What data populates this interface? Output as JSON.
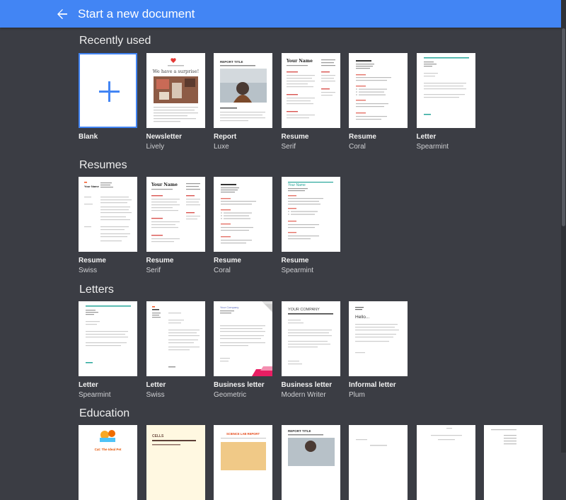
{
  "header": {
    "title": "Start a new document",
    "accent": "#4285f4"
  },
  "sections": {
    "recent": {
      "title": "Recently used",
      "items": [
        {
          "name": "Blank",
          "sub": ""
        },
        {
          "name": "Newsletter",
          "sub": "Lively",
          "preview_heading": "We have a surprise!"
        },
        {
          "name": "Report",
          "sub": "Luxe",
          "preview_heading": "REPORT TITLE"
        },
        {
          "name": "Resume",
          "sub": "Serif",
          "preview_heading": "Your Name"
        },
        {
          "name": "Resume",
          "sub": "Coral"
        },
        {
          "name": "Letter",
          "sub": "Spearmint"
        }
      ]
    },
    "resumes": {
      "title": "Resumes",
      "items": [
        {
          "name": "Resume",
          "sub": "Swiss",
          "preview_heading": "Your Name"
        },
        {
          "name": "Resume",
          "sub": "Serif",
          "preview_heading": "Your Name"
        },
        {
          "name": "Resume",
          "sub": "Coral"
        },
        {
          "name": "Resume",
          "sub": "Spearmint",
          "preview_heading": "Your Name"
        }
      ]
    },
    "letters": {
      "title": "Letters",
      "items": [
        {
          "name": "Letter",
          "sub": "Spearmint"
        },
        {
          "name": "Letter",
          "sub": "Swiss"
        },
        {
          "name": "Business letter",
          "sub": "Geometric",
          "preview_heading": "Your Company"
        },
        {
          "name": "Business letter",
          "sub": "Modern Writer",
          "preview_heading": "YOUR COMPANY"
        },
        {
          "name": "Informal letter",
          "sub": "Plum",
          "preview_heading": "Hello..."
        }
      ]
    },
    "education": {
      "title": "Education",
      "items": [
        {
          "preview_heading": "Cat: The Ideal Pet"
        },
        {
          "preview_heading": "CELLS"
        },
        {
          "preview_heading": "SCIENCE LAB REPORT"
        },
        {
          "preview_heading": "REPORT TITLE"
        },
        {},
        {},
        {}
      ]
    }
  }
}
